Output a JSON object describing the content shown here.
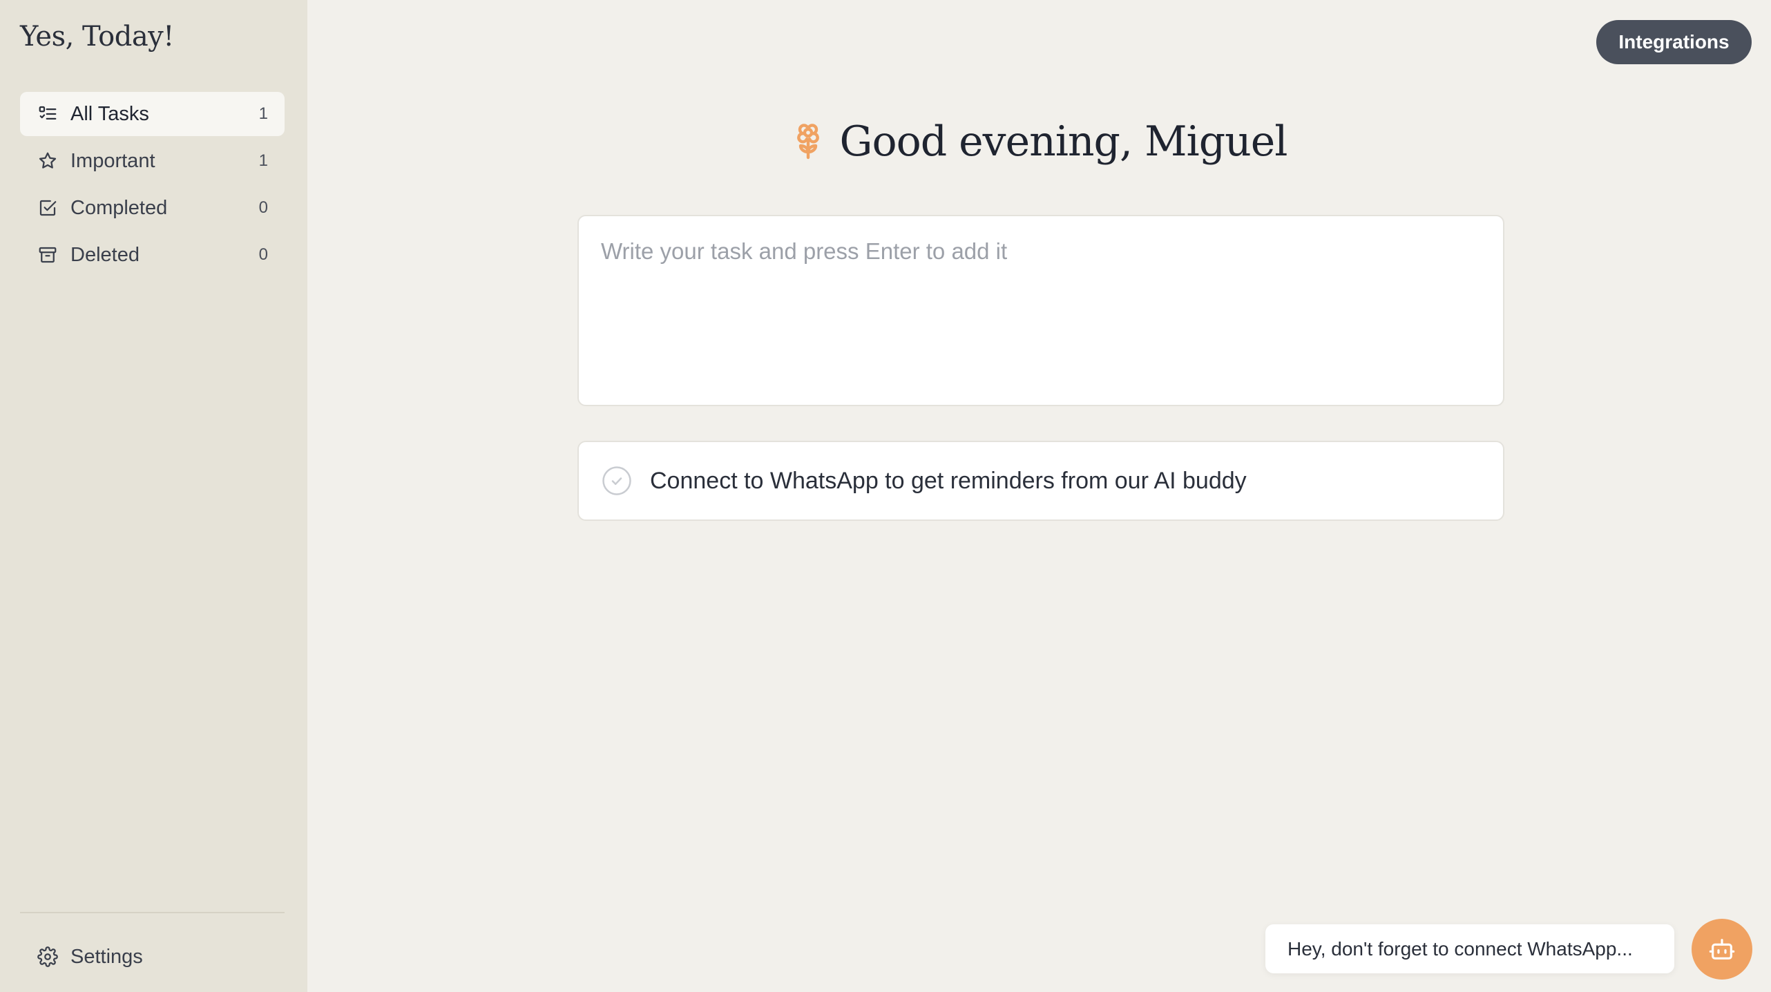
{
  "app": {
    "title": "Yes, Today!"
  },
  "sidebar": {
    "items": [
      {
        "label": "All Tasks",
        "count": "1",
        "icon": "list-check-icon",
        "active": true
      },
      {
        "label": "Important",
        "count": "1",
        "icon": "star-icon",
        "active": false
      },
      {
        "label": "Completed",
        "count": "0",
        "icon": "square-check-icon",
        "active": false
      },
      {
        "label": "Deleted",
        "count": "0",
        "icon": "archive-icon",
        "active": false
      }
    ],
    "settings_label": "Settings",
    "settings_icon": "gear-icon"
  },
  "header": {
    "integrations_label": "Integrations"
  },
  "main": {
    "greeting": "Good evening, Miguel",
    "greeting_icon": "flower-icon",
    "task_input_placeholder": "Write your task and press Enter to add it",
    "task_input_value": "",
    "tasks": [
      {
        "text": "Connect to WhatsApp to get reminders from our AI buddy",
        "completed": false
      }
    ]
  },
  "chat": {
    "toast_text": "Hey, don't forget to connect WhatsApp...",
    "bot_icon": "bot-icon"
  },
  "colors": {
    "sidebar_bg": "#e6e3d8",
    "page_bg": "#f2f0eb",
    "accent_orange": "#f0a262",
    "button_dark": "#4a505c"
  }
}
